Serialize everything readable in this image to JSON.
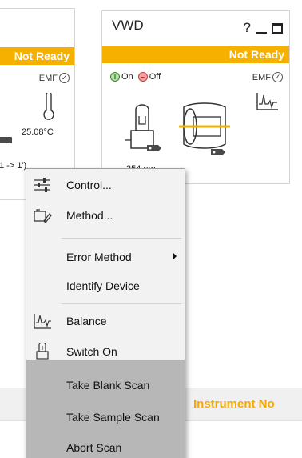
{
  "left_module": {
    "status": "Not Ready",
    "emf_label": "EMF",
    "temperature": "25.08°C",
    "ramp": "1 -> 1')"
  },
  "vwd_module": {
    "title": "VWD",
    "help_glyph": "?",
    "status": "Not Ready",
    "on_label": "On",
    "off_label": "Off",
    "emf_label": "EMF",
    "wavelength": "254 nm"
  },
  "background": {
    "instrument_label": "Instrument No"
  },
  "context_menu": {
    "items": [
      {
        "label": "Control...",
        "icon": "control-sliders-icon"
      },
      {
        "label": "Method...",
        "icon": "method-edit-icon"
      },
      {
        "label": "Error Method",
        "icon": "",
        "submenu": true
      },
      {
        "label": "Identify Device",
        "icon": ""
      },
      {
        "label": "Balance",
        "icon": "balance-signal-icon"
      },
      {
        "label": "Switch On",
        "icon": "lamp-icon"
      },
      {
        "label": "Take Blank Scan",
        "icon": ""
      },
      {
        "label": "Take Sample Scan",
        "icon": ""
      },
      {
        "label": "Abort Scan",
        "icon": ""
      }
    ]
  },
  "colors": {
    "status_bar": "#f6b100",
    "instrument_label": "#f6a800",
    "menu_bg": "#f2f2f2",
    "scan_block_bg": "#b7b7b7"
  }
}
